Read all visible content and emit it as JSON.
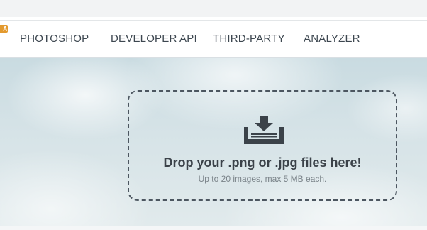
{
  "nav": {
    "badge": "A",
    "items": [
      {
        "label": "PHOTOSHOP"
      },
      {
        "label": "DEVELOPER API"
      },
      {
        "label": "THIRD-PARTY"
      },
      {
        "label": "ANALYZER"
      }
    ]
  },
  "dropzone": {
    "title": "Drop your .png or .jpg files here!",
    "subtitle": "Up to 20 images, max 5 MB each.",
    "icon": "download-tray-icon"
  },
  "colors": {
    "nav_text": "#3d4750",
    "badge": "#e39a2f",
    "dropzone_border": "#4c5660",
    "title_text": "#3b4249"
  }
}
